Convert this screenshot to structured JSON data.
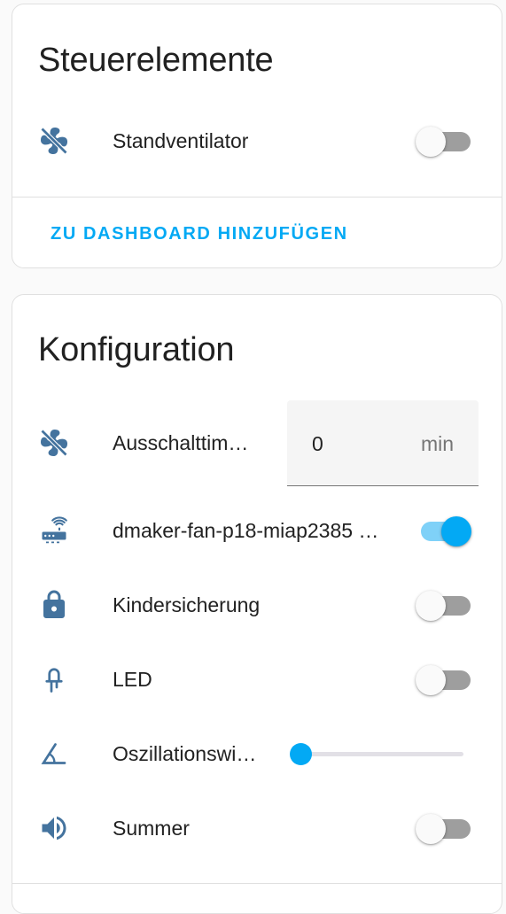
{
  "controls": {
    "title": "Steuerelemente",
    "entities": [
      {
        "icon": "fan-off-icon",
        "label": "Standventilator",
        "state": "off"
      }
    ],
    "action": "ZU DASHBOARD HINZUFÜGEN"
  },
  "configuration": {
    "title": "Konfiguration",
    "timer": {
      "icon": "fan-off-icon",
      "label": "Ausschalttim…",
      "value": "0",
      "unit": "min"
    },
    "wifi": {
      "icon": "router-wireless-icon",
      "label": "dmaker-fan-p18-miap2385 …",
      "state": "on"
    },
    "child_lock": {
      "icon": "lock-icon",
      "label": "Kindersicherung",
      "state": "off"
    },
    "led": {
      "icon": "led-icon",
      "label": "LED",
      "state": "off"
    },
    "oscillation": {
      "icon": "angle-acute-icon",
      "label": "Oszillationswi…",
      "slider_value_fraction": 0
    },
    "buzzer": {
      "icon": "volume-high-icon",
      "label": "Summer",
      "state": "off"
    }
  },
  "colors": {
    "accent": "#03a9f4",
    "icon": "#44739e",
    "switch_off_track": "#9e9e9e",
    "switch_on_track": "#7fd1f8"
  }
}
